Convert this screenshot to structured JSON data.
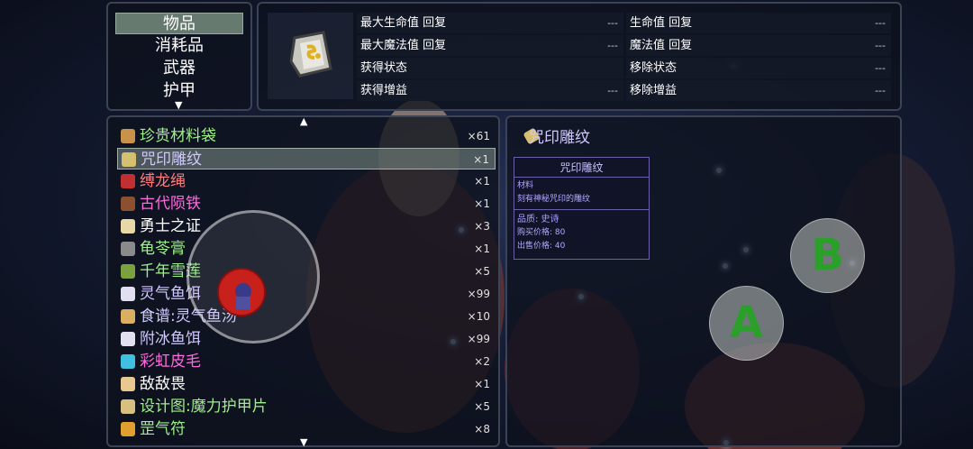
{
  "categories": {
    "items": [
      "物品",
      "消耗品",
      "武器",
      "护甲"
    ],
    "selected_index": 0
  },
  "stats": {
    "left_col": [
      {
        "label": "最大生命值 回复",
        "value": "---"
      },
      {
        "label": "最大魔法值 回复",
        "value": "---"
      },
      {
        "label": "获得状态",
        "value": ""
      },
      {
        "label": "获得增益",
        "value": "---"
      }
    ],
    "right_col": [
      {
        "label": "生命值 回复",
        "value": "---"
      },
      {
        "label": "魔法值 回复",
        "value": "---"
      },
      {
        "label": "移除状态",
        "value": "---"
      },
      {
        "label": "移除增益",
        "value": "---"
      }
    ]
  },
  "inventory": {
    "rows": [
      {
        "name": "珍贵材料袋",
        "count": "×61",
        "color": "#9ef08a",
        "icon_color": "#c8924a"
      },
      {
        "name": "咒印雕纹",
        "count": "×1",
        "color": "#d0c8ff",
        "icon_color": "#d6c070"
      },
      {
        "name": "缚龙绳",
        "count": "×1",
        "color": "#ff7a7a",
        "icon_color": "#c03030"
      },
      {
        "name": "古代陨铁",
        "count": "×1",
        "color": "#ff6adf",
        "icon_color": "#8a5030"
      },
      {
        "name": "勇士之证",
        "count": "×3",
        "color": "#ffffff",
        "icon_color": "#e8d8a8"
      },
      {
        "name": "龟苓膏",
        "count": "×1",
        "color": "#9ef08a",
        "icon_color": "#8a8a8a"
      },
      {
        "name": "千年雪莲",
        "count": "×5",
        "color": "#9ef08a",
        "icon_color": "#7aa040"
      },
      {
        "name": "灵气鱼饵",
        "count": "×99",
        "color": "#d0c8ff",
        "icon_color": "#e0e0f0"
      },
      {
        "name": "食谱:灵气鱼汤",
        "count": "×10",
        "color": "#d0c8ff",
        "icon_color": "#d8b060"
      },
      {
        "name": "附冰鱼饵",
        "count": "×99",
        "color": "#d0c8ff",
        "icon_color": "#e0e0f0"
      },
      {
        "name": "彩虹皮毛",
        "count": "×2",
        "color": "#ff6adf",
        "icon_color": "#40c0e0"
      },
      {
        "name": "敌敌畏",
        "count": "×1",
        "color": "#ffffff",
        "icon_color": "#e8c890"
      },
      {
        "name": "设计图:魔力护甲片",
        "count": "×5",
        "color": "#9ef08a",
        "icon_color": "#d8c080"
      },
      {
        "name": "罡气符",
        "count": "×8",
        "color": "#9ef08a",
        "icon_color": "#e0a030"
      }
    ],
    "selected_index": 1
  },
  "detail": {
    "title": "咒印雕纹",
    "box_title": "咒印雕纹",
    "type": "材料",
    "description": "刻有神秘咒印的雕纹",
    "quality": "品质: 史诗",
    "buy_price": "购买价格: 80",
    "sell_price": "出售价格: 40"
  },
  "controls": {
    "button_a": "A",
    "button_b": "B"
  }
}
